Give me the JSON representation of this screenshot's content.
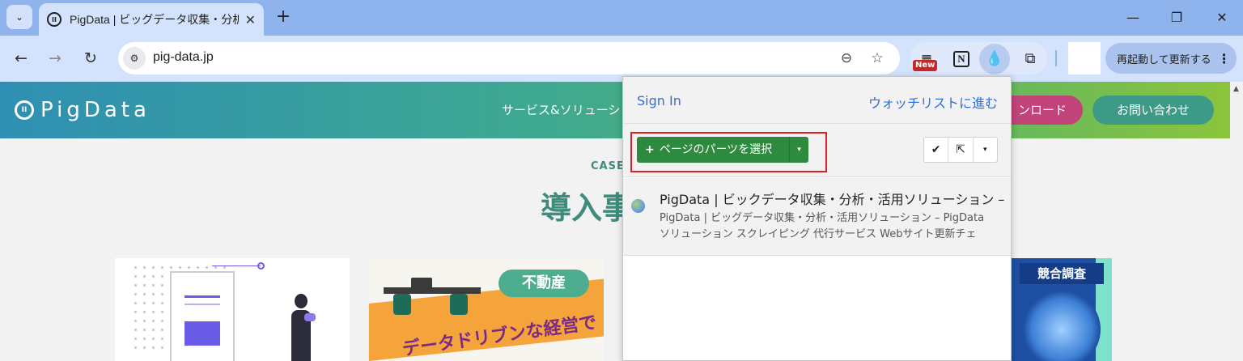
{
  "browser": {
    "tab": {
      "title": "PigData | ビッグデータ収集・分析・活用",
      "close_glyph": "✕"
    },
    "tab_list_glyph": "⌄",
    "new_tab_glyph": "+",
    "window_controls": {
      "minimize": "—",
      "restore": "❐",
      "close": "✕"
    },
    "nav": {
      "back": "←",
      "forward": "→",
      "reload": "↻"
    },
    "site_info_glyph": "⚙",
    "url": "pig-data.jp",
    "omnibox_icons": {
      "zoom": "⊖",
      "bookmark": "☆"
    },
    "extensions": {
      "new_badge": "New",
      "notion_glyph": "N",
      "drop_glyph": "💧",
      "puzzle_glyph": "⧉"
    },
    "restart_label": "再起動して更新する",
    "menu_glyph": "⋮"
  },
  "site": {
    "logo_text": "PigData",
    "logo_mark": "II",
    "nav_link": "サービス&ソリューシ",
    "download_label": "ンロード",
    "contact_label": "お問い合わせ",
    "case_label": "CASE",
    "case_title": "導入事",
    "card1": {},
    "card2": {
      "badge": "不動産",
      "text": "データドリブンな経営で"
    },
    "card3": {
      "badge": "競合調査"
    }
  },
  "popup": {
    "sign_in": "Sign In",
    "watchlist": "ウォッチリストに進む",
    "select_parts": {
      "plus": "+",
      "label": "ページのパーツを選択",
      "caret": "▾"
    },
    "tools": {
      "check": "✔",
      "external": "⇱",
      "caret": "▾"
    },
    "entry": {
      "title": "PigData | ビックデータ収集・分析・活用ソリューション –",
      "desc_line1": "PigData | ビッグデータ収集・分析・活用ソリューション – PigData",
      "desc_line2": "ソリューション スクレイピング 代行サービス Webサイト更新チェ"
    }
  },
  "colors": {
    "chrome_tabbar": "#8fb3ec",
    "chrome_toolbar": "#d3e3fd",
    "header_gradient_start": "#2f8fb3",
    "header_gradient_end": "#8cc43c",
    "accent_green": "#3d8c7c",
    "select_button": "#2d8a3e",
    "highlight_red": "#e02020",
    "link_blue": "#2f6fd6"
  }
}
